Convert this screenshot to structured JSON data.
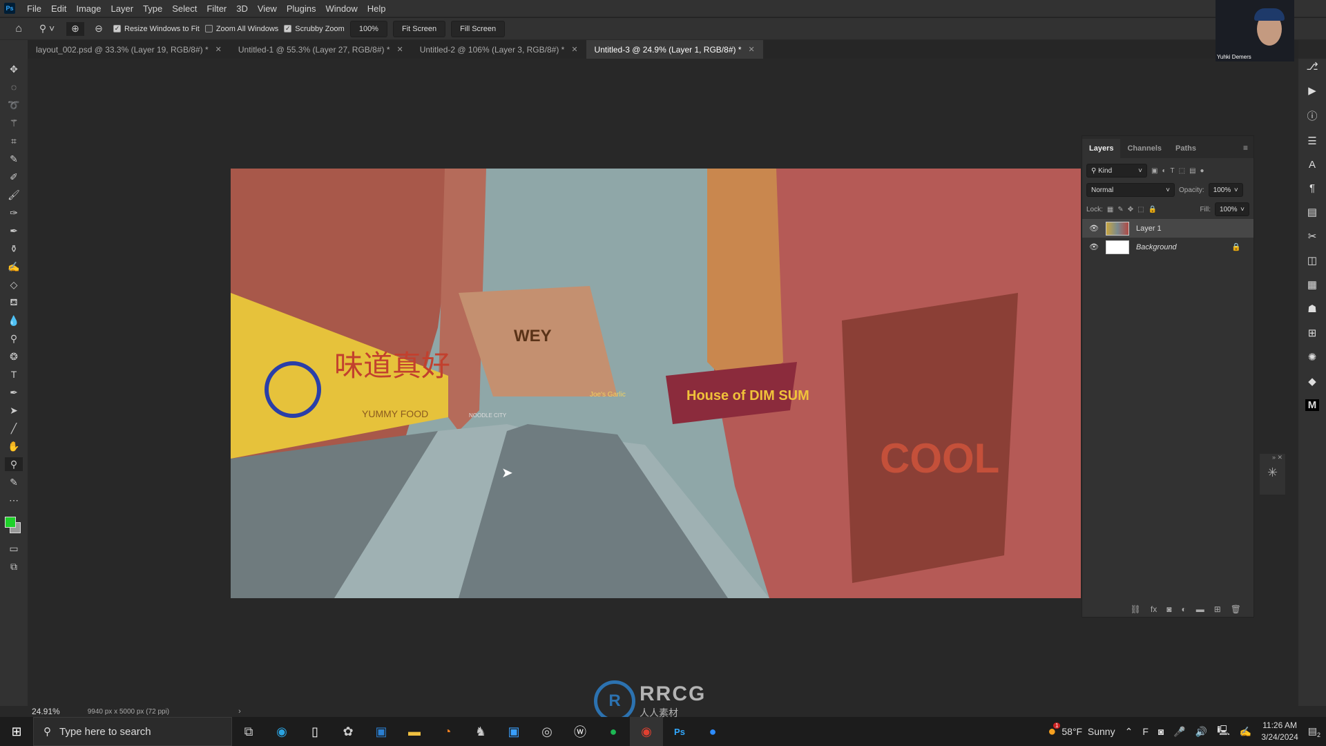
{
  "app": {
    "logo": "Ps"
  },
  "menu": [
    "File",
    "Edit",
    "Image",
    "Layer",
    "Type",
    "Select",
    "Filter",
    "3D",
    "View",
    "Plugins",
    "Window",
    "Help"
  ],
  "options": {
    "resize_windows": {
      "label": "Resize Windows to Fit",
      "checked": true
    },
    "zoom_all": {
      "label": "Zoom All Windows",
      "checked": false
    },
    "scrubby": {
      "label": "Scrubby Zoom",
      "checked": true
    },
    "zoom_value": "100%",
    "fit_screen": "Fit Screen",
    "fill_screen": "Fill Screen"
  },
  "tabs": [
    {
      "label": "layout_002.psd @ 33.3% (Layer 19, RGB/8#) *",
      "active": false
    },
    {
      "label": "Untitled-1 @ 55.3% (Layer 27, RGB/8#) *",
      "active": false
    },
    {
      "label": "Untitled-2 @ 106% (Layer 3, RGB/8#) *",
      "active": false
    },
    {
      "label": "Untitled-3 @ 24.9% (Layer 1, RGB/8#) *",
      "active": true
    }
  ],
  "canvas": {
    "signs": {
      "yellow_chars": "味道真好",
      "yellow_sub": "YUMMY FOOD",
      "dimsum": "House of DIM SUM",
      "tower": "WEY",
      "joes": "Joe's Garlic",
      "noodle": "NOODLE CITY",
      "graffiti": "COOL"
    }
  },
  "layers_panel": {
    "tabs": [
      "Layers",
      "Channels",
      "Paths"
    ],
    "filter": "Kind",
    "blend_mode": "Normal",
    "opacity_label": "Opacity:",
    "opacity": "100%",
    "lock_label": "Lock:",
    "fill_label": "Fill:",
    "fill": "100%",
    "layers": [
      {
        "name": "Layer 1",
        "visible": true,
        "selected": true
      },
      {
        "name": "Background",
        "visible": true,
        "locked": true
      }
    ]
  },
  "status": {
    "zoom": "24.91%",
    "doc_info": "9940 px x 5000 px (72 ppi)"
  },
  "webcam": {
    "name": "Yuhki Demers"
  },
  "watermark": {
    "text": "RRCG",
    "sub": "人人素材"
  },
  "taskbar": {
    "search_placeholder": "Type here to search",
    "weather": "58°F  Sunny",
    "weather_badge": "1",
    "time": "11:26 AM",
    "date": "3/24/2024",
    "notifications": "2"
  },
  "colors": {
    "foreground": "#1fd12a",
    "background": "#9a9a9a",
    "accent": "#31a8ff"
  }
}
